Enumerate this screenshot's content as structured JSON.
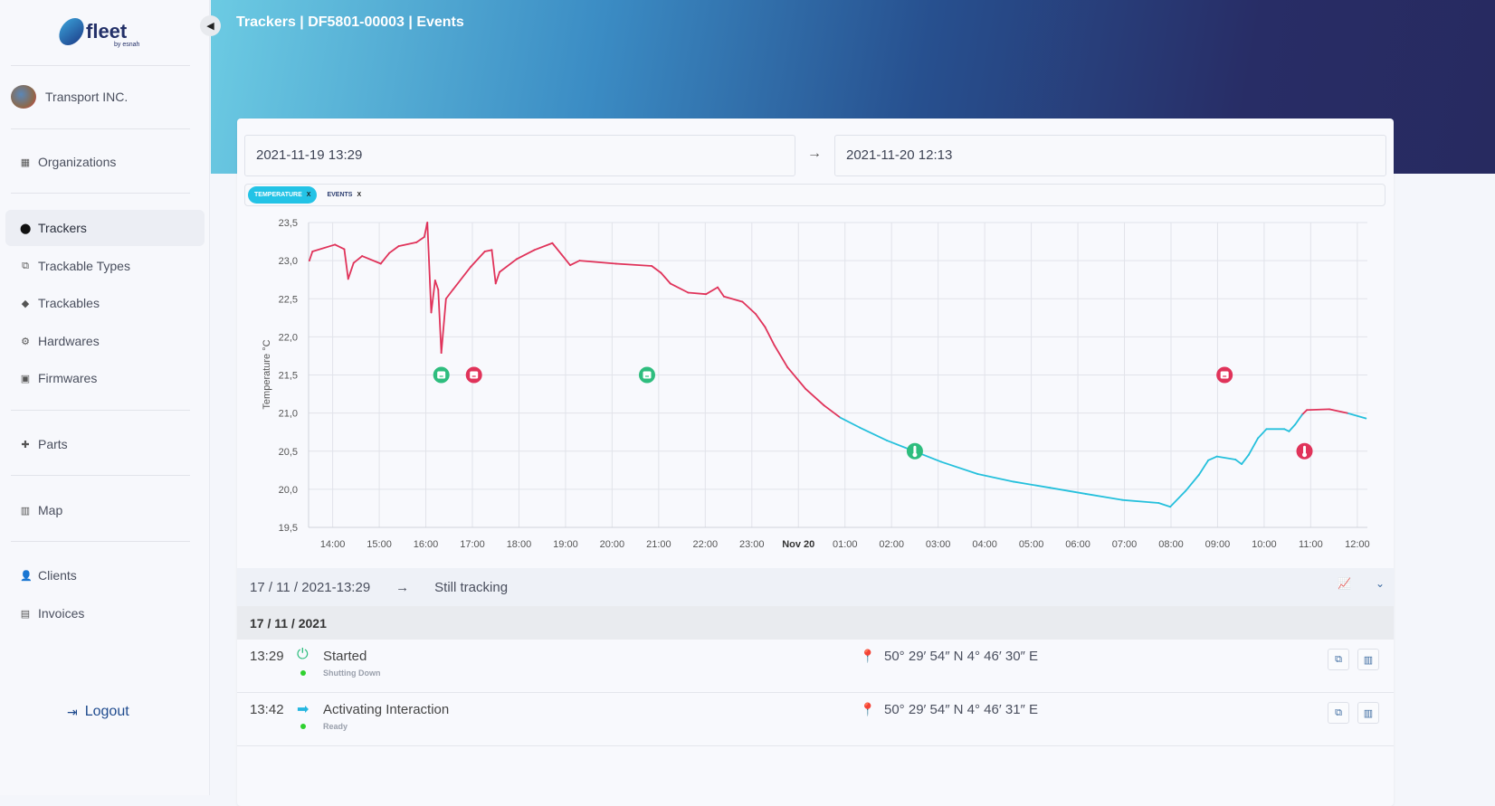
{
  "app": {
    "logo_text": "fleet",
    "logo_sub": "by esnah",
    "organization": "Transport INC."
  },
  "sidebar": {
    "items": [
      {
        "label": "Organizations",
        "icon": "building-icon"
      },
      {
        "label": "Trackers",
        "icon": "map-pin-icon",
        "active": true
      },
      {
        "label": "Trackable Types",
        "icon": "copy-icon"
      },
      {
        "label": "Trackables",
        "icon": "tag-icon"
      },
      {
        "label": "Hardwares",
        "icon": "hardware-icon"
      },
      {
        "label": "Firmwares",
        "icon": "chip-icon"
      },
      {
        "label": "Parts",
        "icon": "puzzle-icon"
      },
      {
        "label": "Map",
        "icon": "map-icon"
      },
      {
        "label": "Clients",
        "icon": "clients-icon"
      },
      {
        "label": "Invoices",
        "icon": "invoice-icon"
      }
    ],
    "logout": "Logout"
  },
  "header": {
    "title": "Trackers | DF5801-00003 | Events"
  },
  "range": {
    "from": "2021-11-19 13:29",
    "to": "2021-11-20 12:13"
  },
  "filters": [
    {
      "label": "TEMPERATURE",
      "active": true
    },
    {
      "label": "EVENTS",
      "active": false
    }
  ],
  "filter_remove": "X",
  "colors": {
    "alert": "#e0335a",
    "normal": "#25c0dc",
    "event_ok": "#2ebd7e",
    "event_alert": "#e0335a"
  },
  "chart_data": {
    "type": "line",
    "ylabel": "Temperature °C",
    "ylim": [
      19.5,
      23.5
    ],
    "yticks": [
      "19,5",
      "20,0",
      "20,5",
      "21,0",
      "21,5",
      "22,0",
      "22,5",
      "23,0",
      "23,5"
    ],
    "xlim": [
      "2021-11-19 13:29",
      "2021-11-20 12:13"
    ],
    "xticks": [
      "14:00",
      "15:00",
      "16:00",
      "17:00",
      "18:00",
      "19:00",
      "20:00",
      "21:00",
      "22:00",
      "23:00",
      "Nov 20",
      "01:00",
      "02:00",
      "03:00",
      "04:00",
      "05:00",
      "06:00",
      "07:00",
      "08:00",
      "09:00",
      "10:00",
      "11:00",
      "12:00"
    ],
    "grid": true,
    "alert_threshold": 21.0,
    "series": [
      {
        "points": [
          [
            "2021-11-19 13:30",
            23.0
          ],
          [
            "2021-11-19 13:34",
            23.12
          ],
          [
            "2021-11-19 14:03",
            23.21
          ],
          [
            "2021-11-19 14:15",
            23.15
          ],
          [
            "2021-11-19 14:20",
            22.76
          ],
          [
            "2021-11-19 14:27",
            22.97
          ],
          [
            "2021-11-19 14:38",
            23.06
          ],
          [
            "2021-11-19 15:02",
            22.96
          ],
          [
            "2021-11-19 15:13",
            23.1
          ],
          [
            "2021-11-19 15:25",
            23.19
          ],
          [
            "2021-11-19 15:48",
            23.24
          ],
          [
            "2021-11-19 15:58",
            23.31
          ],
          [
            "2021-11-19 16:02",
            23.5
          ],
          [
            "2021-11-19 16:07",
            22.32
          ],
          [
            "2021-11-19 16:12",
            22.74
          ],
          [
            "2021-11-19 16:16",
            22.62
          ],
          [
            "2021-11-19 16:20",
            21.79
          ],
          [
            "2021-11-19 16:26",
            22.5
          ],
          [
            "2021-11-19 16:35",
            22.62
          ],
          [
            "2021-11-19 16:58",
            22.92
          ],
          [
            "2021-11-19 17:16",
            23.12
          ],
          [
            "2021-11-19 17:25",
            23.14
          ],
          [
            "2021-11-19 17:30",
            22.7
          ],
          [
            "2021-11-19 17:35",
            22.85
          ],
          [
            "2021-11-19 17:57",
            23.02
          ],
          [
            "2021-11-19 18:20",
            23.14
          ],
          [
            "2021-11-19 18:43",
            23.23
          ],
          [
            "2021-11-19 18:55",
            23.08
          ],
          [
            "2021-11-19 19:06",
            22.94
          ],
          [
            "2021-11-19 19:18",
            23.0
          ],
          [
            "2021-11-19 20:05",
            22.96
          ],
          [
            "2021-11-19 20:51",
            22.93
          ],
          [
            "2021-11-19 21:03",
            22.84
          ],
          [
            "2021-11-19 21:15",
            22.7
          ],
          [
            "2021-11-19 21:38",
            22.58
          ],
          [
            "2021-11-19 22:01",
            22.56
          ],
          [
            "2021-11-19 22:16",
            22.65
          ],
          [
            "2021-11-19 22:24",
            22.53
          ],
          [
            "2021-11-19 22:48",
            22.46
          ],
          [
            "2021-11-19 23:05",
            22.3
          ],
          [
            "2021-11-19 23:17",
            22.13
          ],
          [
            "2021-11-19 23:29",
            21.89
          ],
          [
            "2021-11-19 23:46",
            21.6
          ],
          [
            "2021-11-20 00:09",
            21.32
          ],
          [
            "2021-11-20 00:33",
            21.1
          ],
          [
            "2021-11-20 00:54",
            20.94
          ],
          [
            "2021-11-20 01:19",
            20.81
          ],
          [
            "2021-11-20 01:54",
            20.64
          ],
          [
            "2021-11-20 02:29",
            20.5
          ],
          [
            "2021-11-20 03:04",
            20.36
          ],
          [
            "2021-11-20 03:51",
            20.2
          ],
          [
            "2021-11-20 04:37",
            20.1
          ],
          [
            "2021-11-20 05:24",
            20.02
          ],
          [
            "2021-11-20 06:10",
            19.94
          ],
          [
            "2021-11-20 06:57",
            19.86
          ],
          [
            "2021-11-20 07:44",
            19.82
          ],
          [
            "2021-11-20 07:59",
            19.77
          ],
          [
            "2021-11-20 08:19",
            19.98
          ],
          [
            "2021-11-20 08:36",
            20.19
          ],
          [
            "2021-11-20 08:48",
            20.38
          ],
          [
            "2021-11-20 08:59",
            20.43
          ],
          [
            "2021-11-20 09:23",
            20.39
          ],
          [
            "2021-11-20 09:31",
            20.33
          ],
          [
            "2021-11-20 09:40",
            20.45
          ],
          [
            "2021-11-20 09:52",
            20.67
          ],
          [
            "2021-11-20 10:03",
            20.79
          ],
          [
            "2021-11-20 10:26",
            20.79
          ],
          [
            "2021-11-20 10:32",
            20.76
          ],
          [
            "2021-11-20 10:40",
            20.85
          ],
          [
            "2021-11-20 10:49",
            20.98
          ],
          [
            "2021-11-20 10:55",
            21.04
          ],
          [
            "2021-11-20 11:24",
            21.05
          ],
          [
            "2021-11-20 11:47",
            21.0
          ],
          [
            "2021-11-20 12:11",
            20.93
          ]
        ]
      }
    ],
    "markers": [
      {
        "time": "2021-11-19 16:20",
        "y": 21.5,
        "kind": "event",
        "status": "ok",
        "icon": "box-icon"
      },
      {
        "time": "2021-11-19 17:02",
        "y": 21.5,
        "kind": "event",
        "status": "alert",
        "icon": "box-icon"
      },
      {
        "time": "2021-11-19 20:45",
        "y": 21.5,
        "kind": "event",
        "status": "ok",
        "icon": "box-icon"
      },
      {
        "time": "2021-11-20 09:09",
        "y": 21.5,
        "kind": "event",
        "status": "alert",
        "icon": "box-icon"
      },
      {
        "time": "2021-11-20 02:30",
        "y": 20.5,
        "kind": "temperature",
        "status": "ok",
        "icon": "thermometer-icon"
      },
      {
        "time": "2021-11-20 10:52",
        "y": 20.5,
        "kind": "temperature",
        "status": "alert",
        "icon": "thermometer-icon"
      }
    ]
  },
  "summary": {
    "start": "17 / 11 / 2021-13:29",
    "end": "Still tracking"
  },
  "events": {
    "date": "17 / 11 / 2021",
    "rows": [
      {
        "time": "13:29",
        "name": "Started",
        "state": "Shutting Down",
        "icon": "power-icon",
        "coords": "50° 29′ 54″ N  4° 46′ 30″ E"
      },
      {
        "time": "13:42",
        "name": "Activating Interaction",
        "state": "Ready",
        "icon": "arrow-right-icon",
        "coords": "50° 29′ 54″ N  4° 46′ 31″ E"
      }
    ]
  }
}
